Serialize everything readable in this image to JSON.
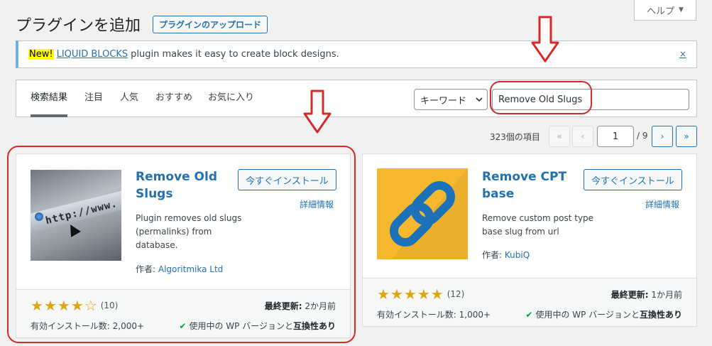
{
  "help": {
    "label": "ヘルプ"
  },
  "header": {
    "title": "プラグインを追加",
    "upload_label": "プラグインのアップロード"
  },
  "notice": {
    "badge": "New!",
    "link": "LIQUID BLOCKS",
    "text": "plugin makes it easy to create block designs.",
    "dismiss": "×"
  },
  "filter": {
    "tabs": [
      "検索結果",
      "注目",
      "人気",
      "おすすめ",
      "お気に入り"
    ],
    "type_select": "キーワード",
    "search_value": "Remove Old Slugs"
  },
  "pagination": {
    "count": "323個の項目",
    "first": "«",
    "prev": "‹",
    "current_page": "1",
    "of_total": "/ 9",
    "next": "›",
    "last": "»"
  },
  "plugins": [
    {
      "name_line1": "Remove Old",
      "name_line2": "Slugs",
      "install": "今すぐインストール",
      "details": "詳細情報",
      "desc_lines": [
        "Plugin removes old slugs",
        "(permalinks) from",
        "database."
      ],
      "author_label": "作者:",
      "author": "Algoritmika Ltd",
      "rating_stars": 4,
      "rating_count": "(10)",
      "updated_label": "最終更新:",
      "updated_value": "2か月前",
      "installs": "有効インストール数: 2,000+",
      "compat_prefix": "使用中の WP バージョンと",
      "compat_bold": "互換性あり",
      "thumb_text": "http://www."
    },
    {
      "name_line1": "Remove CPT",
      "name_line2": "base",
      "install": "今すぐインストール",
      "details": "詳細情報",
      "desc_lines": [
        "Remove custom post type",
        "base slug from url"
      ],
      "author_label": "作者:",
      "author": "KubiQ",
      "rating_stars": 5,
      "rating_count": "(12)",
      "updated_label": "最終更新:",
      "updated_value": "1か月前",
      "installs": "有効インストール数: 1,000+",
      "compat_prefix": "使用中の WP バージョンと",
      "compat_bold": "互換性あり"
    }
  ],
  "colors": {
    "accent": "#2271b1",
    "annotation": "#d42a2a",
    "star": "#dba617",
    "thumb2_bg": "#f5b82e",
    "chain": "#1c72b8"
  }
}
